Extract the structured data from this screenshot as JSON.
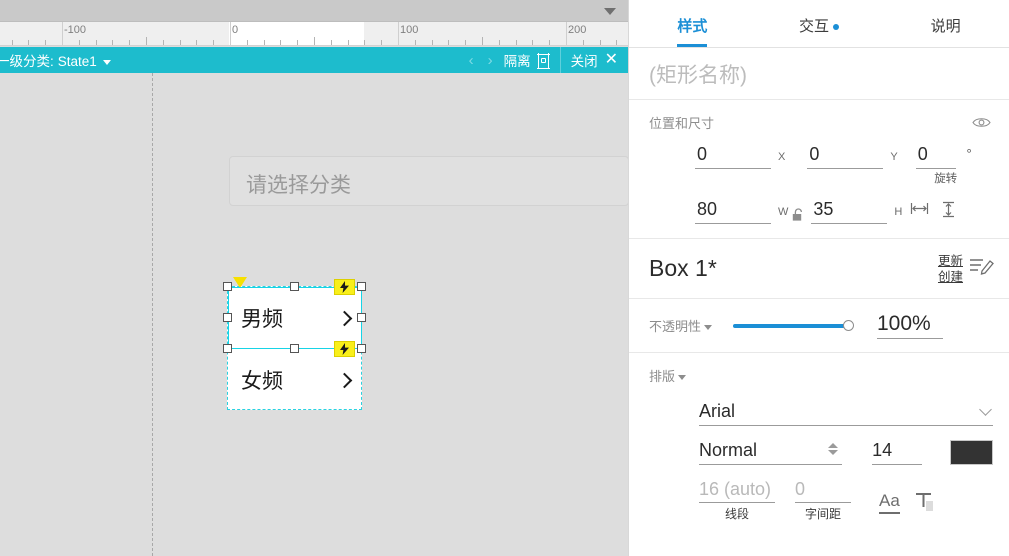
{
  "canvas": {
    "top_strip": {
      "dropdown_icon": "caret-down-icon"
    },
    "ruler": {
      "unit_labels": [
        "-100",
        "0",
        "100",
        "200"
      ],
      "highlight_start": 229,
      "highlight_end": 364
    },
    "state_bar": {
      "widget_name": "一级分类:",
      "state_name": "State1",
      "caret_icon": "caret-down-icon",
      "prev_label": "‹",
      "next_label": "›",
      "isolate_label": "隔离",
      "isolate_icon": "frame-target-icon",
      "close_label": "关闭",
      "close_icon": "close-x-icon",
      "bar_color": "#1dbccd"
    },
    "select_widget": {
      "placeholder": "请选择分类"
    },
    "group": {
      "rows": [
        {
          "label": "男频",
          "chevron_icon": "chevron-right-icon",
          "selected": true
        },
        {
          "label": "女频",
          "chevron_icon": "chevron-right-icon",
          "selected": false
        }
      ],
      "selection_color": "#17d4e6",
      "interaction_badge_icon": "lightning-bolt-icon"
    }
  },
  "panel": {
    "tabs": [
      {
        "label": "样式",
        "active": true,
        "has_dot": false
      },
      {
        "label": "交互",
        "active": false,
        "has_dot": true
      },
      {
        "label": "说明",
        "active": false,
        "has_dot": false
      }
    ],
    "accent_color": "#1b8fd6",
    "name_field": {
      "placeholder": "(矩形名称)",
      "value": ""
    },
    "position_size": {
      "title": "位置和尺寸",
      "visibility_icon": "eye-icon",
      "x_value": "0",
      "x_label": "X",
      "y_value": "0",
      "y_label": "Y",
      "rotation_value": "0",
      "rotation_degree": "°",
      "rotation_label": "旋转",
      "w_value": "80",
      "w_label": "W",
      "h_value": "35",
      "h_label": "H",
      "lock_icon": "unlocked-padlock-icon",
      "fit_width_icon": "fit-width-icon",
      "fit_height_icon": "fit-height-icon"
    },
    "box": {
      "name": "Box 1*",
      "update_label": "更新",
      "create_label": "创建",
      "edit_icon": "edit-list-icon"
    },
    "opacity": {
      "label": "不透明性",
      "caret_icon": "caret-down-icon",
      "value": "100%",
      "percent": 100,
      "slider_color": "#1b8fd6"
    },
    "typography": {
      "title": "排版",
      "caret_icon": "caret-down-icon",
      "font_family": "Arial",
      "font_family_caret_icon": "chevron-down-icon",
      "font_weight": "Normal",
      "weight_spinner_icon": "spinner-updown-icon",
      "font_size": "14",
      "color_swatch": "#333333",
      "line_height_value": "16 (auto)",
      "line_height_label": "线段",
      "letter_spacing_value": "0",
      "letter_spacing_label": "字间距",
      "underline_icon": "underline-Aa-icon",
      "text_fill_icon": "text-fill-icon"
    }
  }
}
